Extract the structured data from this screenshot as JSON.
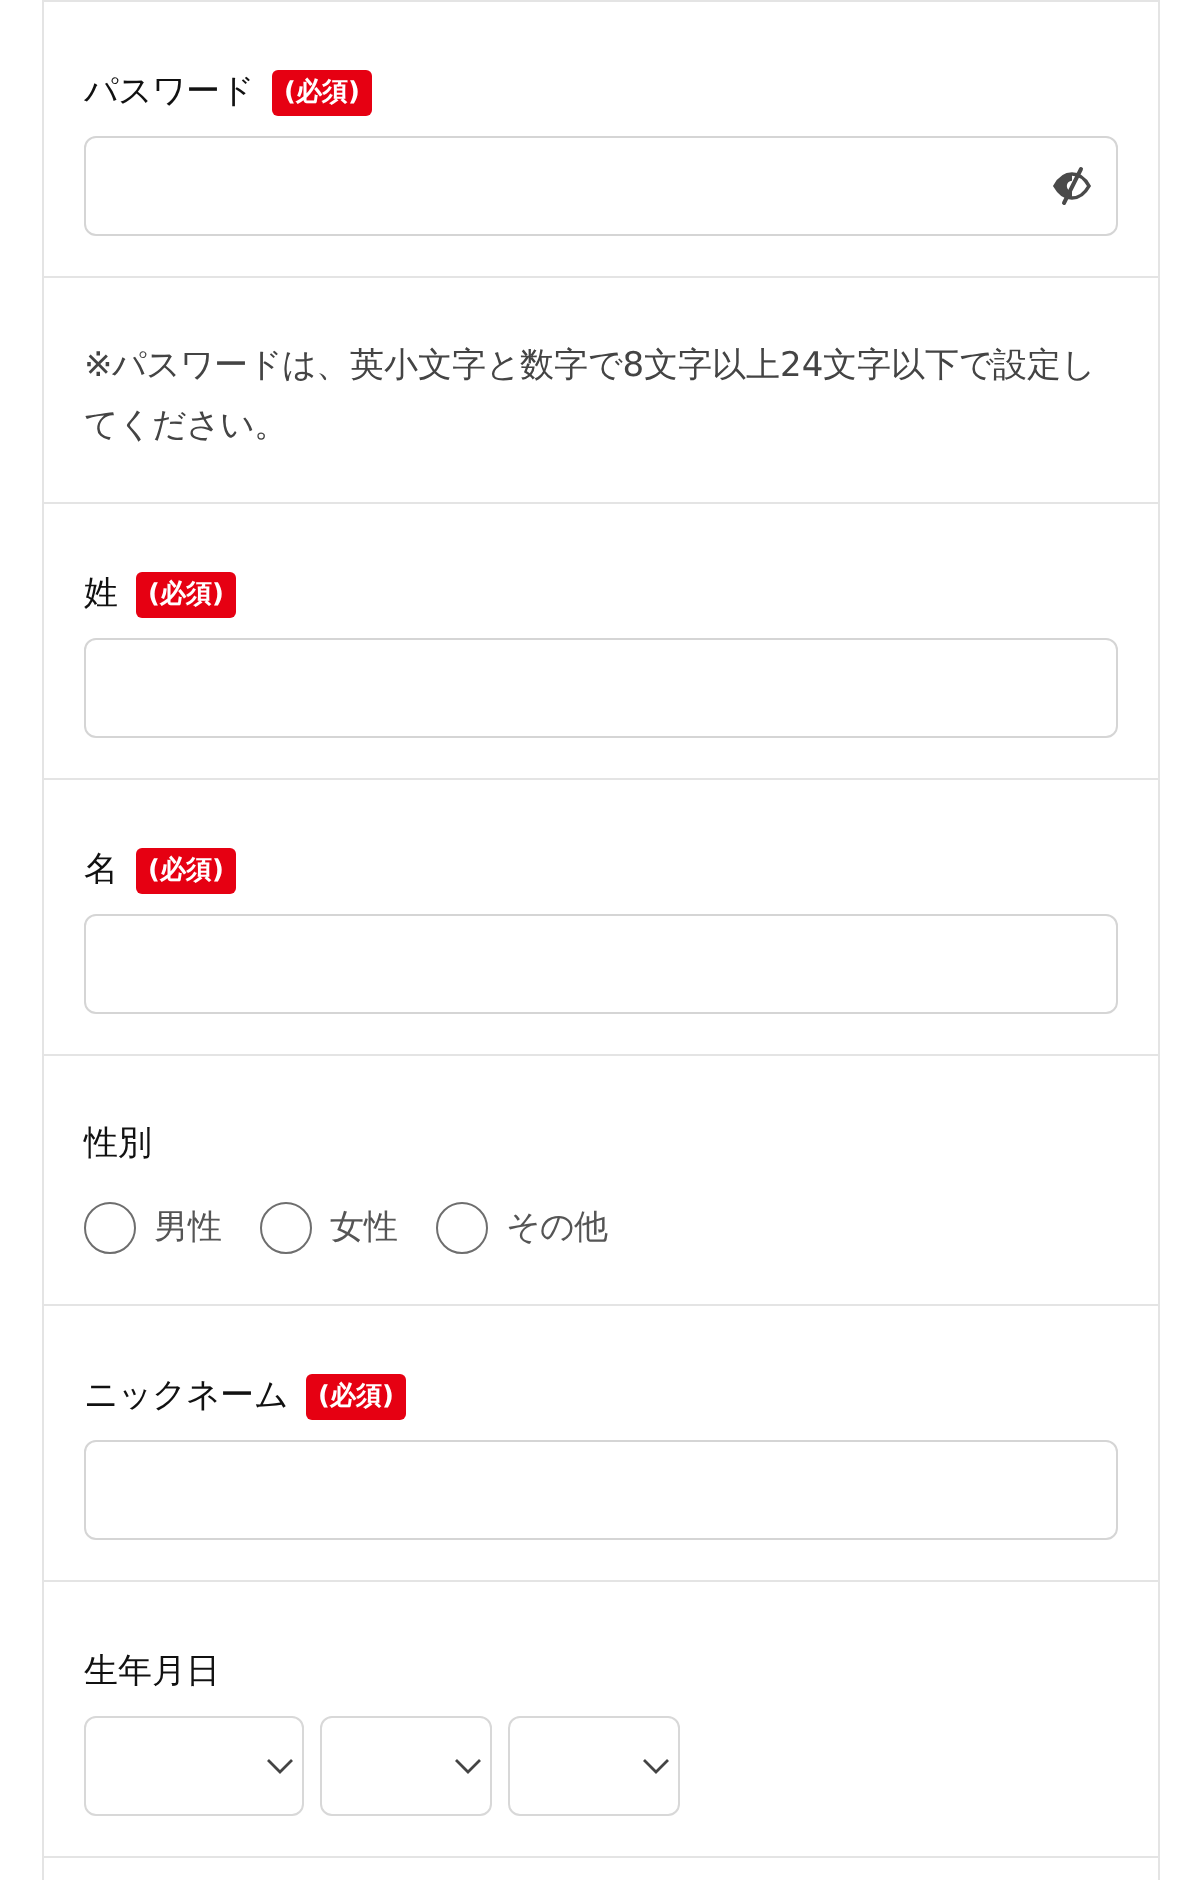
{
  "form": {
    "sections": [
      {
        "kind": "password_input",
        "label": "パスワード",
        "badge": "(必須)"
      },
      {
        "kind": "note",
        "text": "※パスワードは、英小文字と数字で8文字以上24文字以下で設定してください。"
      },
      {
        "kind": "text_input",
        "label": "姓",
        "badge": "(必須)"
      },
      {
        "kind": "text_input",
        "label": "名",
        "badge": "(必須)"
      },
      {
        "kind": "radio_group",
        "label": "性別",
        "options": [
          {
            "label": "男性",
            "selected": false
          },
          {
            "label": "女性",
            "selected": false
          },
          {
            "label": "その他",
            "selected": false
          }
        ]
      },
      {
        "kind": "text_input",
        "label": "ニックネーム",
        "badge": "(必須)"
      },
      {
        "kind": "date_select",
        "label": "生年月日"
      }
    ]
  }
}
